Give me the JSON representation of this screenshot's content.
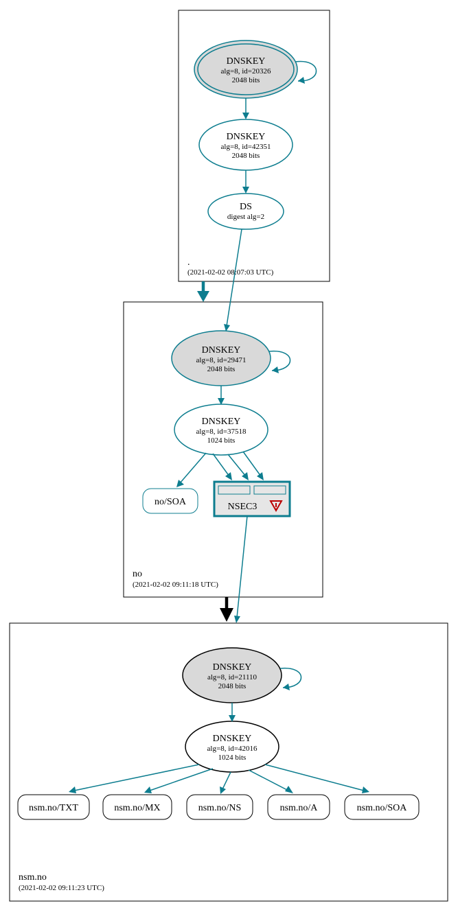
{
  "zones": {
    "root": {
      "name": ".",
      "timestamp": "(2021-02-02 08:07:03 UTC)"
    },
    "no": {
      "name": "no",
      "timestamp": "(2021-02-02 09:11:18 UTC)"
    },
    "nsm": {
      "name": "nsm.no",
      "timestamp": "(2021-02-02 09:11:23 UTC)"
    }
  },
  "root": {
    "ksk": {
      "title": "DNSKEY",
      "line2": "alg=8, id=20326",
      "line3": "2048 bits"
    },
    "zsk": {
      "title": "DNSKEY",
      "line2": "alg=8, id=42351",
      "line3": "2048 bits"
    },
    "ds": {
      "title": "DS",
      "line2": "digest alg=2"
    }
  },
  "no": {
    "ksk": {
      "title": "DNSKEY",
      "line2": "alg=8, id=29471",
      "line3": "2048 bits"
    },
    "zsk": {
      "title": "DNSKEY",
      "line2": "alg=8, id=37518",
      "line3": "1024 bits"
    },
    "soa": {
      "label": "no/SOA"
    },
    "nsec": {
      "label": "NSEC3"
    }
  },
  "nsm": {
    "ksk": {
      "title": "DNSKEY",
      "line2": "alg=8, id=21110",
      "line3": "2048 bits"
    },
    "zsk": {
      "title": "DNSKEY",
      "line2": "alg=8, id=42016",
      "line3": "1024 bits"
    },
    "rr": {
      "txt": "nsm.no/TXT",
      "mx": "nsm.no/MX",
      "ns": "nsm.no/NS",
      "a": "nsm.no/A",
      "soa": "nsm.no/SOA"
    }
  }
}
